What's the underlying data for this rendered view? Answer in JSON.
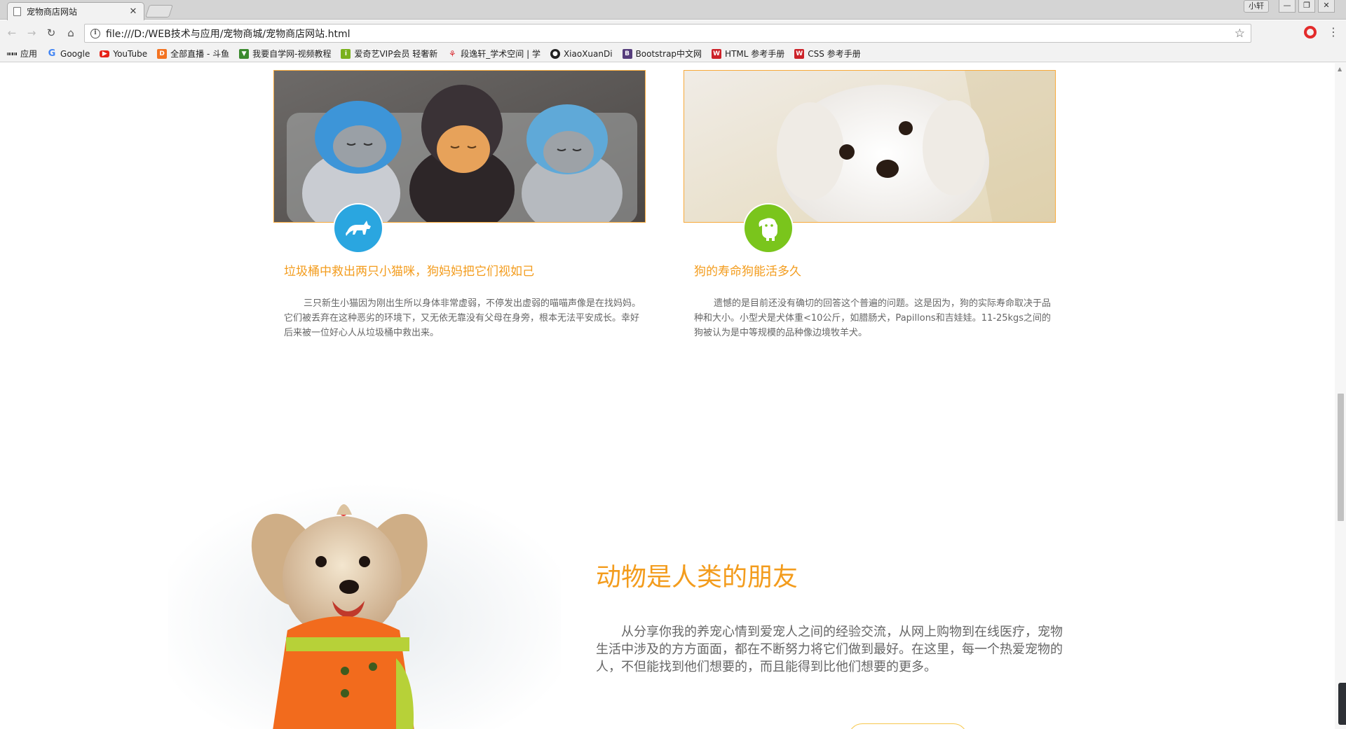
{
  "browser": {
    "tab_title": "宠物商店网站",
    "tab_close": "✕",
    "user_label": "小轩",
    "url": "file:///D:/WEB技术与应用/宠物商城/宠物商店网站.html",
    "bookmarks": [
      {
        "label": "应用",
        "icon": "apps-icon"
      },
      {
        "label": "Google",
        "icon": "google-icon",
        "color": "#4285f4"
      },
      {
        "label": "YouTube",
        "icon": "youtube-icon",
        "color": "#e62117"
      },
      {
        "label": "全部直播 - 斗鱼",
        "icon": "douyu-icon",
        "color": "#f37321"
      },
      {
        "label": "我要自学网-视频教程",
        "icon": "zixue-icon",
        "color": "#3b8a2e"
      },
      {
        "label": "爱奇艺VIP会员 轻奢新",
        "icon": "iqiyi-icon",
        "color": "#7ab11c"
      },
      {
        "label": "段逸轩_学术空间 | 学",
        "icon": "xueshu-icon",
        "color": "#d8262c"
      },
      {
        "label": "XiaoXuanDi",
        "icon": "github-icon",
        "color": "#222222"
      },
      {
        "label": "Bootstrap中文网",
        "icon": "bootstrap-icon",
        "color": "#563d7c"
      },
      {
        "label": "HTML 参考手册",
        "icon": "w3school-icon",
        "color": "#cc2229"
      },
      {
        "label": "CSS 参考手册",
        "icon": "w3school-icon",
        "color": "#cc2229"
      }
    ]
  },
  "cards": [
    {
      "title": "垃圾桶中救出两只小猫咪，狗妈妈把它们视如己",
      "text": "三只新生小猫因为刚出生所以身体非常虚弱，不停发出虚弱的喵喵声像是在找妈妈。它们被丢弃在这种恶劣的环境下，又无依无靠没有父母在身旁，根本无法平安成长。幸好后来被一位好心人从垃圾桶中救出来。",
      "badge_color": "#2aa6e0",
      "badge_icon": "cat-icon"
    },
    {
      "title": "狗的寿命狗能活多久",
      "text": "遗憾的是目前还没有确切的回答这个普遍的问题。这是因为，狗的实际寿命取决于品种和大小。小型犬是犬体重<10公斤，如腊肠犬，Papillons和吉娃娃。11-25kgs之间的狗被认为是中等规模的品种像边境牧羊犬。",
      "badge_color": "#7ac51c",
      "badge_icon": "dog-icon"
    }
  ],
  "hero": {
    "title": "动物是人类的朋友",
    "text": "从分享你我的养宠心情到爱宠人之间的经验交流，从网上购物到在线医疗，宠物生活中涉及的方方面面，都在不断努力将它们做到最好。在这里，每一个热爱宠物的人，不但能找到他们想要的，而且能得到比他们想要的更多。"
  }
}
